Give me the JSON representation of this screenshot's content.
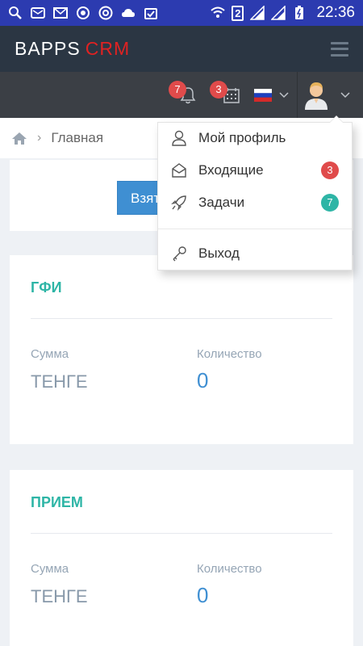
{
  "statusbar": {
    "time": "22:36",
    "sim": "2"
  },
  "appbar": {
    "logo_main": "BAPPS",
    "logo_accent": "CRM"
  },
  "toolbar": {
    "notifications_count": "7",
    "calendar_count": "3"
  },
  "breadcrumb": {
    "home_label": "Главная"
  },
  "action": {
    "take_label": "Взят"
  },
  "dropdown": {
    "profile": "Мой профиль",
    "inbox": "Входящие",
    "inbox_count": "3",
    "tasks": "Задачи",
    "tasks_count": "7",
    "logout": "Выход"
  },
  "cards": [
    {
      "title": "ГФИ",
      "sum_label": "Сумма",
      "sum_value": "ТЕНГЕ",
      "count_label": "Количество",
      "count_value": "0"
    },
    {
      "title": "ПРИЕМ",
      "sum_label": "Сумма",
      "sum_value": "ТЕНГЕ",
      "count_label": "Количество",
      "count_value": "0"
    }
  ],
  "colors": {
    "statusbar": "#2c3bb0",
    "header": "#2b3643",
    "toolbar": "#3b3f45",
    "accent_teal": "#2eb5a6",
    "accent_blue": "#3f8fd2",
    "badge_red": "#e04b4b",
    "crm_red": "#e02222"
  }
}
